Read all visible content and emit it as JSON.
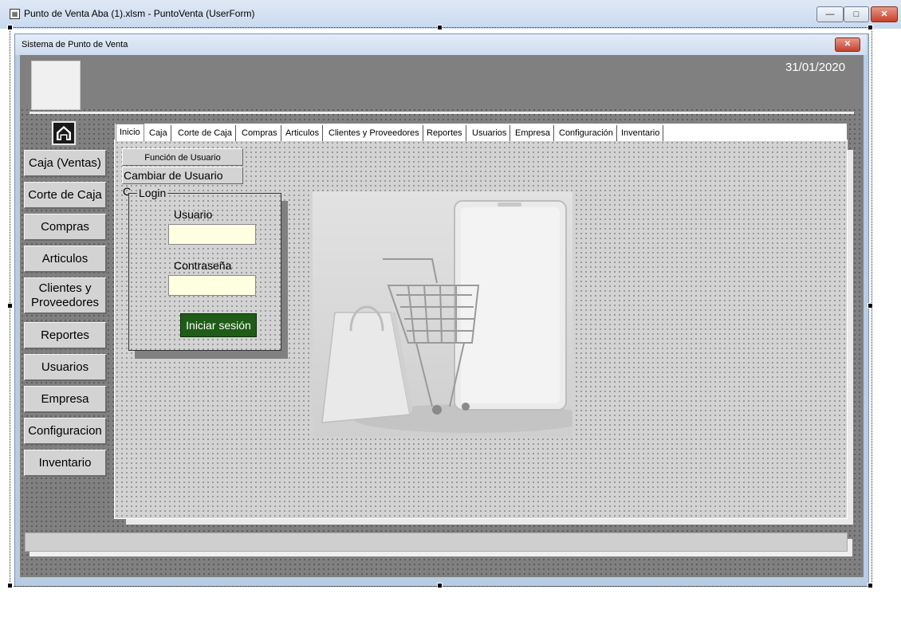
{
  "window": {
    "title": "Punto de Venta Aba (1).xlsm - PuntoVenta (UserForm)",
    "minimize": "—",
    "maximize": "□",
    "close": "✕"
  },
  "form": {
    "title": "Sistema de Punto de Venta",
    "close": "✕",
    "date": "31/01/2020"
  },
  "sidebar": {
    "home_icon": "home-icon",
    "items": [
      {
        "label": "Caja (Ventas)"
      },
      {
        "label": "Corte de Caja"
      },
      {
        "label": "Compras"
      },
      {
        "label": "Articulos"
      },
      {
        "label": "Clientes y Proveedores"
      },
      {
        "label": "Reportes"
      },
      {
        "label": "Usuarios"
      },
      {
        "label": "Empresa"
      },
      {
        "label": "Configuracion"
      },
      {
        "label": "Inventario"
      }
    ]
  },
  "tabs": [
    {
      "label": "Inicio",
      "active": true
    },
    {
      "label": "Caja"
    },
    {
      "label": "Corte de Caja"
    },
    {
      "label": "Compras"
    },
    {
      "label": "Articulos"
    },
    {
      "label": "Clientes y Proveedores"
    },
    {
      "label": "Reportes"
    },
    {
      "label": "Usuarios"
    },
    {
      "label": "Empresa"
    },
    {
      "label": "Configuración"
    },
    {
      "label": "Inventario"
    }
  ],
  "inicio": {
    "funcion_button": "Función de Usuario",
    "cambiar_button": "Cambiar de Usuario",
    "stray_char": "C",
    "login": {
      "caption": "Login",
      "user_label": "Usuario",
      "user_value": "",
      "password_label": "Contraseña",
      "password_value": "",
      "submit": "Iniciar sesión"
    },
    "image_icon": "shopping-cart-bag-tablet-image"
  },
  "colors": {
    "login_button": "#1f5c17",
    "input_bg": "#ffffe1",
    "panel_gray": "#808080"
  }
}
